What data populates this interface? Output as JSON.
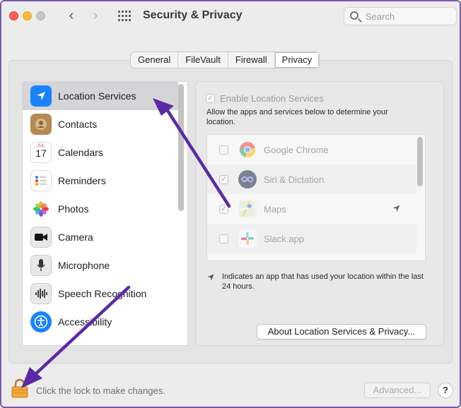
{
  "window": {
    "title": "Security & Privacy"
  },
  "search": {
    "placeholder": "Search"
  },
  "tabs": [
    {
      "label": "General",
      "active": false
    },
    {
      "label": "FileVault",
      "active": false
    },
    {
      "label": "Firewall",
      "active": false
    },
    {
      "label": "Privacy",
      "active": true
    }
  ],
  "sidebar": {
    "items": [
      {
        "label": "Location Services",
        "icon": "location-arrow-icon",
        "selected": true
      },
      {
        "label": "Contacts",
        "icon": "contacts-icon",
        "selected": false
      },
      {
        "label": "Calendars",
        "icon": "calendar-icon",
        "selected": false,
        "icon_month": "JUL",
        "icon_day": "17"
      },
      {
        "label": "Reminders",
        "icon": "reminders-icon",
        "selected": false
      },
      {
        "label": "Photos",
        "icon": "photos-icon",
        "selected": false
      },
      {
        "label": "Camera",
        "icon": "camera-icon",
        "selected": false
      },
      {
        "label": "Microphone",
        "icon": "microphone-icon",
        "selected": false
      },
      {
        "label": "Speech Recognition",
        "icon": "speech-recognition-icon",
        "selected": false
      },
      {
        "label": "Accessibility",
        "icon": "accessibility-icon",
        "selected": false
      }
    ]
  },
  "location": {
    "enable_label": "Enable Location Services",
    "enable_checked": true,
    "description": "Allow the apps and services below to determine your location.",
    "apps": [
      {
        "name": "Google Chrome",
        "checked": false,
        "icon": "chrome-icon",
        "recent": false
      },
      {
        "name": "Siri & Dictation",
        "checked": true,
        "icon": "siri-icon",
        "recent": false
      },
      {
        "name": "Maps",
        "checked": true,
        "icon": "maps-icon",
        "recent": true
      },
      {
        "name": "Slack.app",
        "checked": false,
        "icon": "slack-icon",
        "recent": false
      }
    ],
    "note": "Indicates an app that has used your location within the last 24 hours.",
    "about_button": "About Location Services & Privacy..."
  },
  "footer": {
    "lock_text": "Click the lock to make changes.",
    "advanced_button": "Advanced...",
    "help_button": "?"
  },
  "colors": {
    "accent": "#1a82fb",
    "annotation_arrow": "#5b2aa6"
  }
}
